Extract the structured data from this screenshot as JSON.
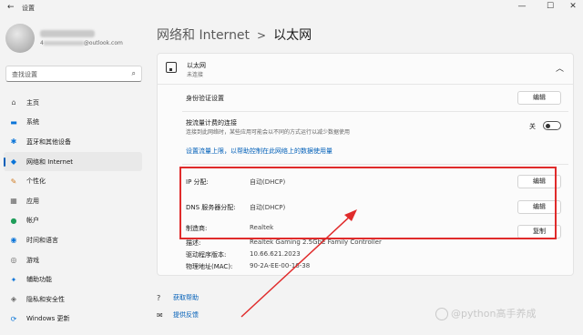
{
  "window": {
    "title": "设置",
    "back": "←",
    "min": "—",
    "max": "☐",
    "close": "✕"
  },
  "profile": {
    "email_suffix": "@outlook.com"
  },
  "search": {
    "placeholder": "查找设置",
    "icon": "search-icon"
  },
  "sidebar": {
    "items": [
      {
        "label": "主页",
        "icon": "home-icon",
        "glyph": "⌂",
        "color": "#555555"
      },
      {
        "label": "系统",
        "icon": "system-icon",
        "glyph": "▬",
        "color": "#0a74d8"
      },
      {
        "label": "蓝牙和其他设备",
        "icon": "bluetooth-icon",
        "glyph": "✱",
        "color": "#0a74d8"
      },
      {
        "label": "网络和 Internet",
        "icon": "network-icon",
        "glyph": "◆",
        "color": "#0a74d8",
        "active": true
      },
      {
        "label": "个性化",
        "icon": "personalization-icon",
        "glyph": "✎",
        "color": "#d07a1f"
      },
      {
        "label": "应用",
        "icon": "apps-icon",
        "glyph": "▦",
        "color": "#666666"
      },
      {
        "label": "帐户",
        "icon": "account-icon",
        "glyph": "●",
        "color": "#1f9e5a"
      },
      {
        "label": "时间和语言",
        "icon": "time-language-icon",
        "glyph": "◉",
        "color": "#0a74d8"
      },
      {
        "label": "游戏",
        "icon": "gaming-icon",
        "glyph": "◎",
        "color": "#666666"
      },
      {
        "label": "辅助功能",
        "icon": "accessibility-icon",
        "glyph": "✦",
        "color": "#0a74d8"
      },
      {
        "label": "隐私和安全性",
        "icon": "privacy-icon",
        "glyph": "◈",
        "color": "#666666"
      },
      {
        "label": "Windows 更新",
        "icon": "windows-update-icon",
        "glyph": "⟳",
        "color": "#0a74d8"
      }
    ]
  },
  "breadcrumb": {
    "parent": "网络和 Internet",
    "separator": ">",
    "current": "以太网"
  },
  "ethernet": {
    "name": "以太网",
    "status": "未连接",
    "auth_label": "身份验证设置",
    "auth_button": "编辑",
    "metered_label": "按流量计费的连接",
    "metered_desc": "连接到此网络时，某些应用可能会以不同的方式运行以减少数据使用",
    "metered_state": "关",
    "data_limit_link": "设置流量上限，以帮助控制在此网络上的数据使用量",
    "ip_label": "IP 分配:",
    "ip_value": "自动(DHCP)",
    "ip_button": "编辑",
    "dns_label": "DNS 服务器分配:",
    "dns_value": "自动(DHCP)",
    "dns_button": "编辑",
    "mfr_label": "制造商:",
    "mfr_value": "Realtek",
    "copy_button": "复制",
    "desc_label": "描述:",
    "desc_value": "Realtek Gaming 2.5GbE Family Controller",
    "driver_label": "驱动程序版本:",
    "driver_value": "10.66.621.2023",
    "mac_label": "物理地址(MAC):",
    "mac_value": "90-2A-EE-00-16-38"
  },
  "help": {
    "get_help": "获取帮助",
    "feedback": "提供反馈"
  },
  "watermark": "@python高手养成",
  "colors": {
    "accent": "#005fb8",
    "annotation": "#e02b2b"
  }
}
